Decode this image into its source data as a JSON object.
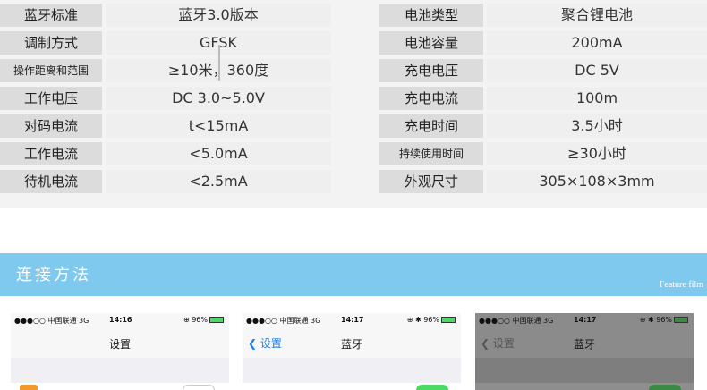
{
  "spec_left": [
    {
      "label": "蓝牙标准",
      "value": "蓝牙3.0版本"
    },
    {
      "label": "调制方式",
      "value": "GFSK"
    },
    {
      "label": "操作距离和范围",
      "value": "≥10米，360度"
    },
    {
      "label": "工作电压",
      "value": "DC 3.0~5.0V"
    },
    {
      "label": "对码电流",
      "value": "t<15mA"
    },
    {
      "label": "工作电流",
      "value": "<5.0mA"
    },
    {
      "label": "待机电流",
      "value": "<2.5mA"
    }
  ],
  "spec_right": [
    {
      "label": "电池类型",
      "value": "聚合锂电池"
    },
    {
      "label": "电池容量",
      "value": "200mA"
    },
    {
      "label": "充电电压",
      "value": "DC 5V"
    },
    {
      "label": "充电电流",
      "value": "100m"
    },
    {
      "label": "充电时间",
      "value": "3.5小时"
    },
    {
      "label": "持续使用时间",
      "value": "≥30小时"
    },
    {
      "label": "外观尺寸",
      "value": "305×108×3mm"
    }
  ],
  "banner": {
    "title": "连接方法",
    "subtitle": "Feature film"
  },
  "phones": [
    {
      "carrier": "●●●○○ 中国联通  3G",
      "time": "14:16",
      "status_right": "⊕ 96%",
      "title": "设置",
      "back": ""
    },
    {
      "carrier": "●●●○○ 中国联通  3G",
      "time": "14:17",
      "status_right": "⊕ ✱ 96%",
      "title": "蓝牙",
      "back": "设置"
    },
    {
      "carrier": "●●●○○ 中国联通  3G",
      "time": "14:17",
      "status_right": "⊕ ✱ 96%",
      "title": "蓝牙",
      "back": "设置"
    }
  ],
  "colors": {
    "banner": "#7fc9ef",
    "label_bg": "#dcdcdc",
    "value_bg": "#efefef",
    "toggle_on": "#4cd964"
  }
}
